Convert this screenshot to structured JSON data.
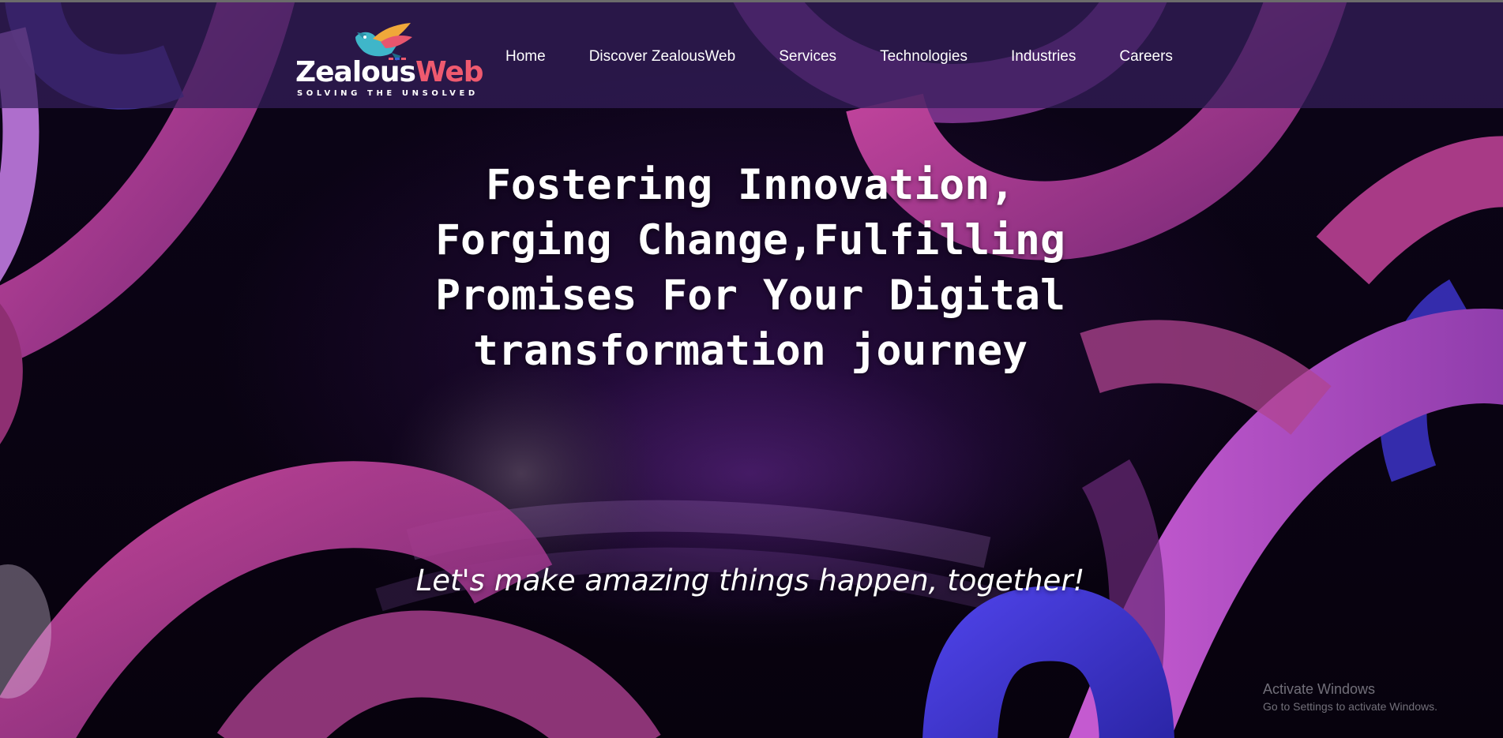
{
  "logo": {
    "name_main": "Zealous",
    "name_accent": "Web",
    "tagline": "SOLVING THE UNSOLVED",
    "icon": "bird-logo-icon"
  },
  "nav": {
    "items": [
      {
        "label": "Home"
      },
      {
        "label": "Discover ZealousWeb"
      },
      {
        "label": "Services"
      },
      {
        "label": "Technologies"
      },
      {
        "label": "Industries"
      },
      {
        "label": "Careers"
      }
    ]
  },
  "hero": {
    "title_lines": [
      "Fostering Innovation,",
      "Forging Change,Fulfilling",
      "Promises For Your Digital",
      "transformation journey"
    ],
    "tagline": "Let's make amazing things happen, together!"
  },
  "watermark": {
    "title": "Activate Windows",
    "subtitle": "Go to Settings to activate Windows."
  },
  "colors": {
    "navbar_bg": "#341e5c",
    "logo_accent": "#ef5a6f",
    "ribbon_magenta": "#b03a86",
    "ribbon_blue": "#3f35d6",
    "ribbon_violet": "#7a3fb8",
    "page_bg": "#07020d"
  }
}
